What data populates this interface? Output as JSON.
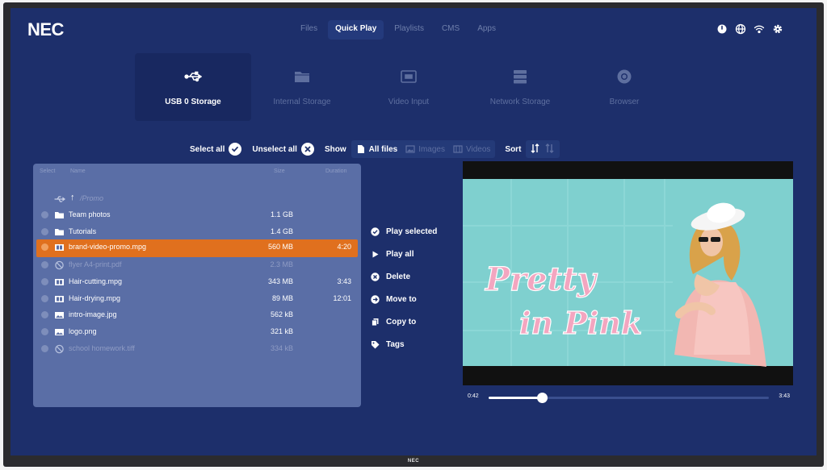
{
  "brand": "NEC",
  "bezel_logo": "NEC",
  "nav": {
    "tabs": [
      {
        "label": "Files",
        "active": false
      },
      {
        "label": "Quick Play",
        "active": true
      },
      {
        "label": "Playlists",
        "active": false
      },
      {
        "label": "CMS",
        "active": false
      },
      {
        "label": "Apps",
        "active": false
      }
    ],
    "system_icons": [
      "power-icon",
      "globe-icon",
      "wifi-icon",
      "gear-icon"
    ]
  },
  "sources": [
    {
      "label": "USB 0 Storage",
      "icon": "usb-icon",
      "active": true
    },
    {
      "label": "Internal Storage",
      "icon": "folder-icon",
      "active": false
    },
    {
      "label": "Video Input",
      "icon": "video-input-icon",
      "active": false
    },
    {
      "label": "Network Storage",
      "icon": "network-storage-icon",
      "active": false
    },
    {
      "label": "Browser",
      "icon": "browser-icon",
      "active": false
    }
  ],
  "toolbar": {
    "select_all": "Select all",
    "unselect_all": "Unselect all",
    "show": "Show",
    "filters": [
      {
        "label": "All files",
        "icon": "file-icon",
        "selected": true
      },
      {
        "label": "Images",
        "icon": "image-icon",
        "selected": false
      },
      {
        "label": "Videos",
        "icon": "film-icon",
        "selected": false
      }
    ],
    "sort": "Sort"
  },
  "file_table": {
    "headers": {
      "select": "Select",
      "name": "Name",
      "size": "Size",
      "duration": "Duration"
    },
    "path": "/Promo",
    "rows": [
      {
        "name": "Team photos",
        "size": "1.1 GB",
        "duration": "",
        "icon": "folder-icon",
        "state": "normal"
      },
      {
        "name": "Tutorials",
        "size": "1.4 GB",
        "duration": "",
        "icon": "folder-icon",
        "state": "normal"
      },
      {
        "name": "brand-video-promo.mpg",
        "size": "560 MB",
        "duration": "4:20",
        "icon": "film-icon",
        "state": "selected"
      },
      {
        "name": "flyer A4-print.pdf",
        "size": "2.3 MB",
        "duration": "",
        "icon": "blocked-icon",
        "state": "disabled"
      },
      {
        "name": "Hair-cutting.mpg",
        "size": "343 MB",
        "duration": "3:43",
        "icon": "film-icon",
        "state": "normal"
      },
      {
        "name": "Hair-drying.mpg",
        "size": "89 MB",
        "duration": "12:01",
        "icon": "film-icon",
        "state": "normal"
      },
      {
        "name": "intro-image.jpg",
        "size": "562 kB",
        "duration": "",
        "icon": "image-icon",
        "state": "normal"
      },
      {
        "name": "logo.png",
        "size": "321 kB",
        "duration": "",
        "icon": "image-icon",
        "state": "normal"
      },
      {
        "name": "school homework.tiff",
        "size": "334 kB",
        "duration": "",
        "icon": "blocked-icon",
        "state": "disabled"
      }
    ]
  },
  "actions": [
    {
      "label": "Play selected",
      "icon": "check-circle-icon"
    },
    {
      "label": "Play all",
      "icon": "play-icon"
    },
    {
      "label": "Delete",
      "icon": "delete-icon"
    },
    {
      "label": "Move to",
      "icon": "move-icon"
    },
    {
      "label": "Copy to",
      "icon": "copy-icon"
    },
    {
      "label": "Tags",
      "icon": "tag-icon"
    }
  ],
  "player": {
    "overlay_text_line1": "Pretty",
    "overlay_text_line2": "in Pink",
    "time_elapsed": "0:42",
    "time_total": "3:43",
    "progress_fraction": 0.19
  },
  "colors": {
    "background": "#1d2f6b",
    "accent": "#e0701e",
    "panel": "#5a6ea6",
    "preview_bg": "#7fd0cf",
    "title_pink": "#f3a6c0"
  }
}
